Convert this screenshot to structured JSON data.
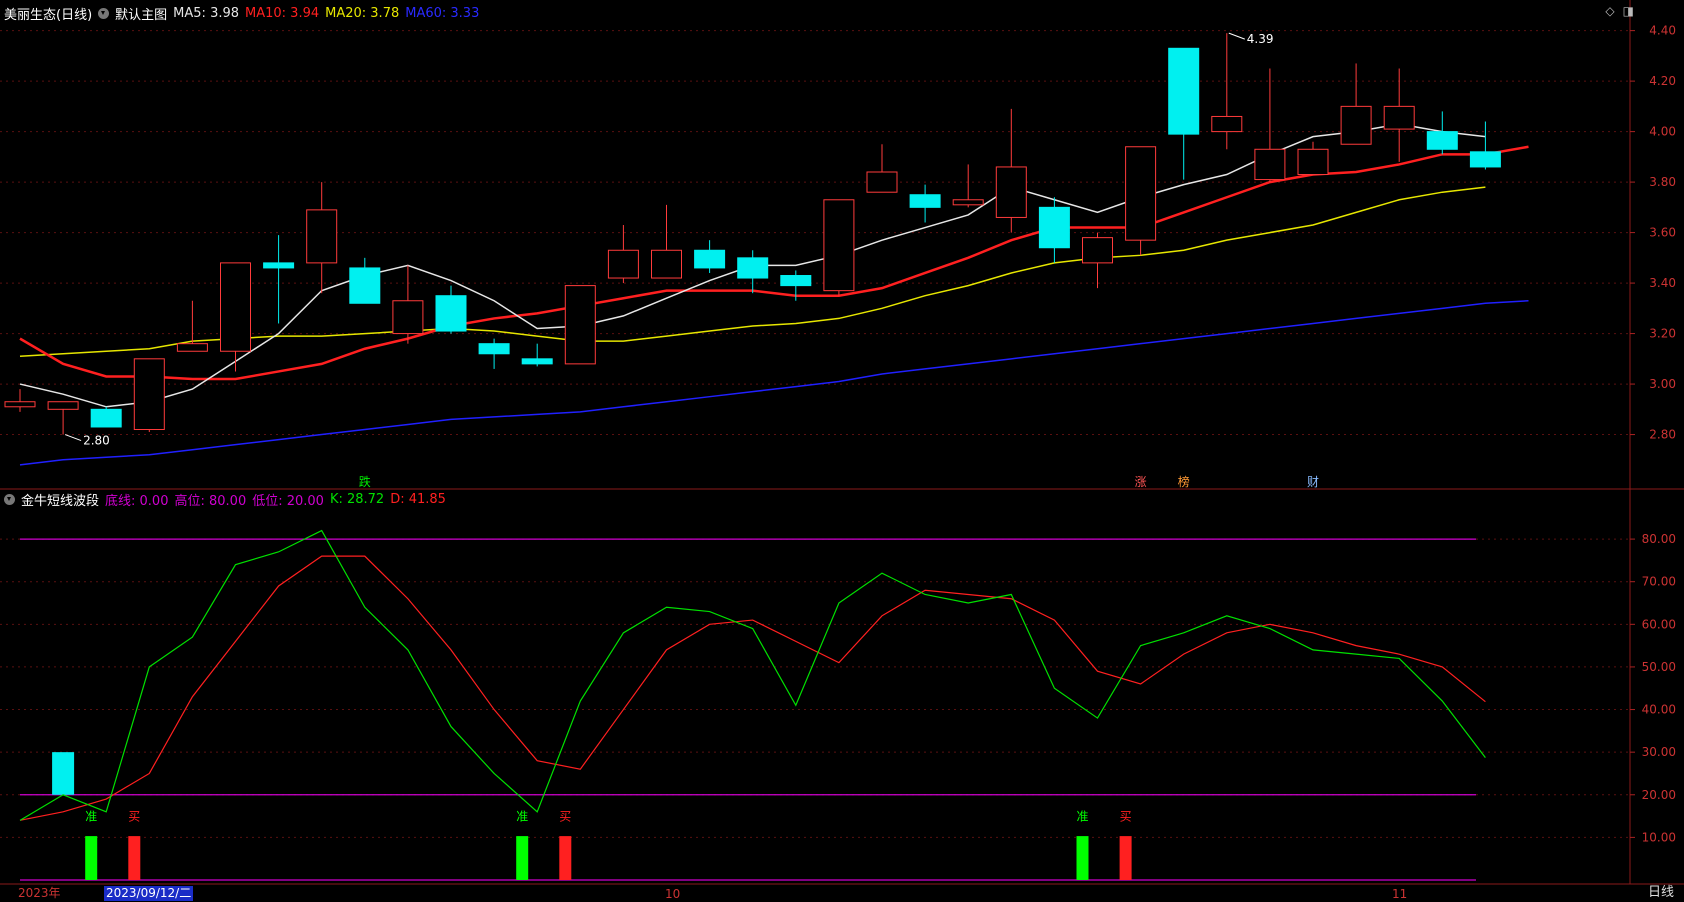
{
  "colors": {
    "up": "#ff3b3b",
    "down": "#00f0f0",
    "ma5": "#e6e6e6",
    "ma10": "#ff2020",
    "ma20": "#e6e600",
    "ma60": "#2020ff",
    "k": "#00e000",
    "d": "#ff2020",
    "level": "#d000d0",
    "axis": "#aa2222",
    "grid": "#5a1010"
  },
  "header": {
    "stock": "美丽生态(日线)",
    "template": "默认主图",
    "ma5": "MA5: 3.98",
    "ma10": "MA10: 3.94",
    "ma20": "MA20: 3.78",
    "ma60": "MA60: 3.33"
  },
  "indicator_header": {
    "name": "金牛短线波段",
    "bottom_line": "底线: 0.00",
    "high": "高位: 80.00",
    "low": "低位: 20.00",
    "k": "K: 28.72",
    "d": "D: 41.85"
  },
  "x_axis": {
    "year": "2023年",
    "cursor_date": "2023/09/12/二",
    "month1": "10",
    "month2": "11"
  },
  "period": "日线",
  "chart_data": [
    {
      "type": "candlestick",
      "ylim": [
        2.62,
        4.45
      ],
      "yticks": [
        "4.40",
        "4.20",
        "4.00",
        "3.80",
        "3.60",
        "3.40",
        "3.20",
        "3.00",
        "2.80"
      ],
      "ytick_values": [
        4.4,
        4.2,
        4.0,
        3.8,
        3.6,
        3.4,
        3.2,
        3.0,
        2.8
      ],
      "candles": [
        {
          "o": 2.91,
          "h": 2.98,
          "l": 2.89,
          "c": 2.93
        },
        {
          "o": 2.9,
          "h": 2.93,
          "l": 2.8,
          "c": 2.93
        },
        {
          "o": 2.9,
          "h": 2.91,
          "l": 2.83,
          "c": 2.83
        },
        {
          "o": 2.82,
          "h": 3.1,
          "l": 2.81,
          "c": 3.1
        },
        {
          "o": 3.13,
          "h": 3.33,
          "l": 3.13,
          "c": 3.16
        },
        {
          "o": 3.13,
          "h": 3.48,
          "l": 3.05,
          "c": 3.48
        },
        {
          "o": 3.48,
          "h": 3.59,
          "l": 3.24,
          "c": 3.46
        },
        {
          "o": 3.48,
          "h": 3.8,
          "l": 3.36,
          "c": 3.69
        },
        {
          "o": 3.46,
          "h": 3.5,
          "l": 3.32,
          "c": 3.32
        },
        {
          "o": 3.2,
          "h": 3.47,
          "l": 3.16,
          "c": 3.33
        },
        {
          "o": 3.35,
          "h": 3.39,
          "l": 3.2,
          "c": 3.21
        },
        {
          "o": 3.16,
          "h": 3.18,
          "l": 3.06,
          "c": 3.12
        },
        {
          "o": 3.1,
          "h": 3.16,
          "l": 3.07,
          "c": 3.08
        },
        {
          "o": 3.08,
          "h": 3.39,
          "l": 3.08,
          "c": 3.39
        },
        {
          "o": 3.42,
          "h": 3.63,
          "l": 3.4,
          "c": 3.53
        },
        {
          "o": 3.42,
          "h": 3.71,
          "l": 3.42,
          "c": 3.53
        },
        {
          "o": 3.53,
          "h": 3.57,
          "l": 3.44,
          "c": 3.46
        },
        {
          "o": 3.5,
          "h": 3.53,
          "l": 3.36,
          "c": 3.42
        },
        {
          "o": 3.43,
          "h": 3.45,
          "l": 3.33,
          "c": 3.39
        },
        {
          "o": 3.37,
          "h": 3.73,
          "l": 3.35,
          "c": 3.73
        },
        {
          "o": 3.76,
          "h": 3.95,
          "l": 3.76,
          "c": 3.84
        },
        {
          "o": 3.75,
          "h": 3.79,
          "l": 3.64,
          "c": 3.7
        },
        {
          "o": 3.71,
          "h": 3.87,
          "l": 3.7,
          "c": 3.73
        },
        {
          "o": 3.66,
          "h": 4.09,
          "l": 3.6,
          "c": 3.86
        },
        {
          "o": 3.7,
          "h": 3.74,
          "l": 3.48,
          "c": 3.54
        },
        {
          "o": 3.48,
          "h": 3.6,
          "l": 3.38,
          "c": 3.58
        },
        {
          "o": 3.57,
          "h": 3.94,
          "l": 3.51,
          "c": 3.94
        },
        {
          "o": 4.33,
          "h": 4.33,
          "l": 3.81,
          "c": 3.99
        },
        {
          "o": 4.0,
          "h": 4.39,
          "l": 3.93,
          "c": 4.06
        },
        {
          "o": 3.81,
          "h": 4.25,
          "l": 3.8,
          "c": 3.93
        },
        {
          "o": 3.83,
          "h": 3.96,
          "l": 3.83,
          "c": 3.93
        },
        {
          "o": 3.95,
          "h": 4.27,
          "l": 3.95,
          "c": 4.1
        },
        {
          "o": 4.01,
          "h": 4.25,
          "l": 3.88,
          "c": 4.1
        },
        {
          "o": 4.0,
          "h": 4.08,
          "l": 3.91,
          "c": 3.93
        },
        {
          "o": 3.92,
          "h": 4.04,
          "l": 3.85,
          "c": 3.86
        }
      ],
      "ma5": [
        3.0,
        2.96,
        2.91,
        2.93,
        2.98,
        3.09,
        3.2,
        3.37,
        3.43,
        3.47,
        3.41,
        3.33,
        3.22,
        3.23,
        3.27,
        3.34,
        3.41,
        3.47,
        3.47,
        3.51,
        3.57,
        3.62,
        3.67,
        3.78,
        3.73,
        3.68,
        3.74,
        3.79,
        3.83,
        3.91,
        3.98,
        4.0,
        4.03,
        4.0,
        3.98
      ],
      "ma10": [
        3.18,
        3.08,
        3.03,
        3.03,
        3.02,
        3.02,
        3.05,
        3.08,
        3.14,
        3.18,
        3.23,
        3.26,
        3.28,
        3.31,
        3.34,
        3.37,
        3.37,
        3.37,
        3.35,
        3.35,
        3.38,
        3.44,
        3.5,
        3.57,
        3.62,
        3.62,
        3.62,
        3.68,
        3.74,
        3.8,
        3.83,
        3.84,
        3.87,
        3.91,
        3.91,
        3.94
      ],
      "ma20": [
        3.11,
        3.12,
        3.13,
        3.14,
        3.17,
        3.18,
        3.19,
        3.19,
        3.2,
        3.21,
        3.22,
        3.21,
        3.19,
        3.17,
        3.17,
        3.19,
        3.21,
        3.23,
        3.24,
        3.26,
        3.3,
        3.35,
        3.39,
        3.44,
        3.48,
        3.5,
        3.51,
        3.53,
        3.57,
        3.6,
        3.63,
        3.68,
        3.73,
        3.76,
        3.78
      ],
      "ma60": [
        2.68,
        2.7,
        2.71,
        2.72,
        2.74,
        2.76,
        2.78,
        2.8,
        2.82,
        2.84,
        2.86,
        2.87,
        2.88,
        2.89,
        2.91,
        2.93,
        2.95,
        2.97,
        2.99,
        3.01,
        3.04,
        3.06,
        3.08,
        3.1,
        3.12,
        3.14,
        3.16,
        3.18,
        3.2,
        3.22,
        3.24,
        3.26,
        3.28,
        3.3,
        3.32,
        3.33
      ],
      "annotations": [
        {
          "candle": 1,
          "text": "2.80",
          "price": 2.8
        },
        {
          "candle": 28,
          "text": "4.39",
          "price": 4.39
        }
      ],
      "markers": [
        {
          "candle": 8,
          "text": "跌",
          "color": "#00ee00"
        },
        {
          "candle": 26,
          "text": "涨",
          "color": "#ff5555"
        },
        {
          "candle": 27,
          "text": "榜",
          "color": "#ff9933"
        },
        {
          "candle": 30,
          "text": "财",
          "color": "#88bbff"
        }
      ]
    },
    {
      "type": "line",
      "title": "金牛短线波段",
      "ylim": [
        0,
        88
      ],
      "yticks": [
        "80.00",
        "70.00",
        "60.00",
        "50.00",
        "40.00",
        "30.00",
        "20.00",
        "10.00"
      ],
      "ytick_values": [
        80,
        70,
        60,
        50,
        40,
        30,
        20,
        10
      ],
      "levels": [
        80,
        20,
        0
      ],
      "series": [
        {
          "name": "K",
          "values": [
            14,
            20,
            16,
            50,
            57,
            74,
            77,
            82,
            64,
            54,
            36,
            25,
            16,
            42,
            58,
            64,
            63,
            59,
            41,
            65,
            72,
            67,
            65,
            67,
            45,
            38,
            55,
            58,
            62,
            59,
            54,
            53,
            52,
            42,
            28.72
          ]
        },
        {
          "name": "D",
          "values": [
            14,
            16,
            19,
            25,
            43,
            56,
            69,
            76,
            76,
            66,
            54,
            40,
            28,
            26,
            40,
            54,
            60,
            61,
            56,
            51,
            62,
            68,
            67,
            66,
            61,
            49,
            46,
            53,
            58,
            60,
            58,
            55,
            53,
            50,
            41.85
          ]
        }
      ],
      "bars": [
        {
          "candle": 1,
          "from": 20,
          "to": 30,
          "color": "#00f0f0"
        }
      ],
      "signals": [
        {
          "candle": 2,
          "text": "准",
          "color": "#00ff00"
        },
        {
          "candle": 3,
          "text": "买",
          "color": "#ff2020"
        },
        {
          "candle": 12,
          "text": "准",
          "color": "#00ff00"
        },
        {
          "candle": 13,
          "text": "买",
          "color": "#ff2020"
        },
        {
          "candle": 25,
          "text": "准",
          "color": "#00ff00"
        },
        {
          "candle": 26,
          "text": "买",
          "color": "#ff2020"
        }
      ]
    }
  ]
}
